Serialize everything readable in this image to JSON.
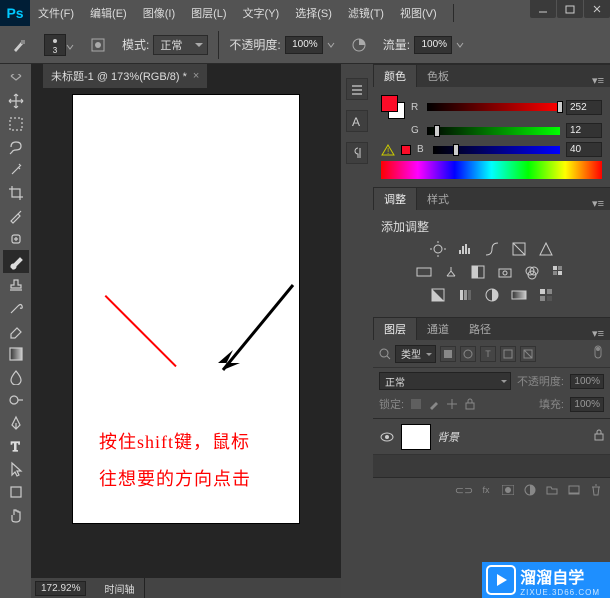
{
  "app": {
    "logo": "Ps"
  },
  "menu": {
    "items": [
      "文件(F)",
      "编辑(E)",
      "图像(I)",
      "图层(L)",
      "文字(Y)",
      "选择(S)",
      "滤镜(T)",
      "视图(V)"
    ]
  },
  "options": {
    "brush_size": "3",
    "mode_label": "模式:",
    "mode_value": "正常",
    "opacity_label": "不透明度:",
    "opacity_value": "100%",
    "flow_label": "流量:",
    "flow_value": "100%"
  },
  "document": {
    "tab_title": "未标题-1 @ 173%(RGB/8) *",
    "zoom": "172.92%",
    "status_tab": "时间轴",
    "canvas_text1": "按住shift键，鼠标",
    "canvas_text2": "往想要的方向点击"
  },
  "panels": {
    "color": {
      "tabs": [
        "颜色",
        "色板"
      ],
      "r": {
        "label": "R",
        "value": "252",
        "thumb_pct": 98
      },
      "g": {
        "label": "G",
        "value": "12",
        "thumb_pct": 5
      },
      "b": {
        "label": "B",
        "value": "40",
        "thumb_pct": 16
      },
      "swatch": "#fc0c28"
    },
    "adjust": {
      "tabs": [
        "调整",
        "样式"
      ],
      "title": "添加调整"
    },
    "layers": {
      "tabs": [
        "图层",
        "通道",
        "路径"
      ],
      "kind_label": "类型",
      "blend_value": "正常",
      "opacity_label": "不透明度:",
      "opacity_value": "100%",
      "lock_label": "锁定:",
      "fill_label": "填充:",
      "fill_value": "100%",
      "rows": [
        {
          "name": "背景"
        }
      ]
    }
  },
  "watermark": {
    "text": "溜溜自学",
    "sub": "ZIXUE.3D66.COM"
  }
}
